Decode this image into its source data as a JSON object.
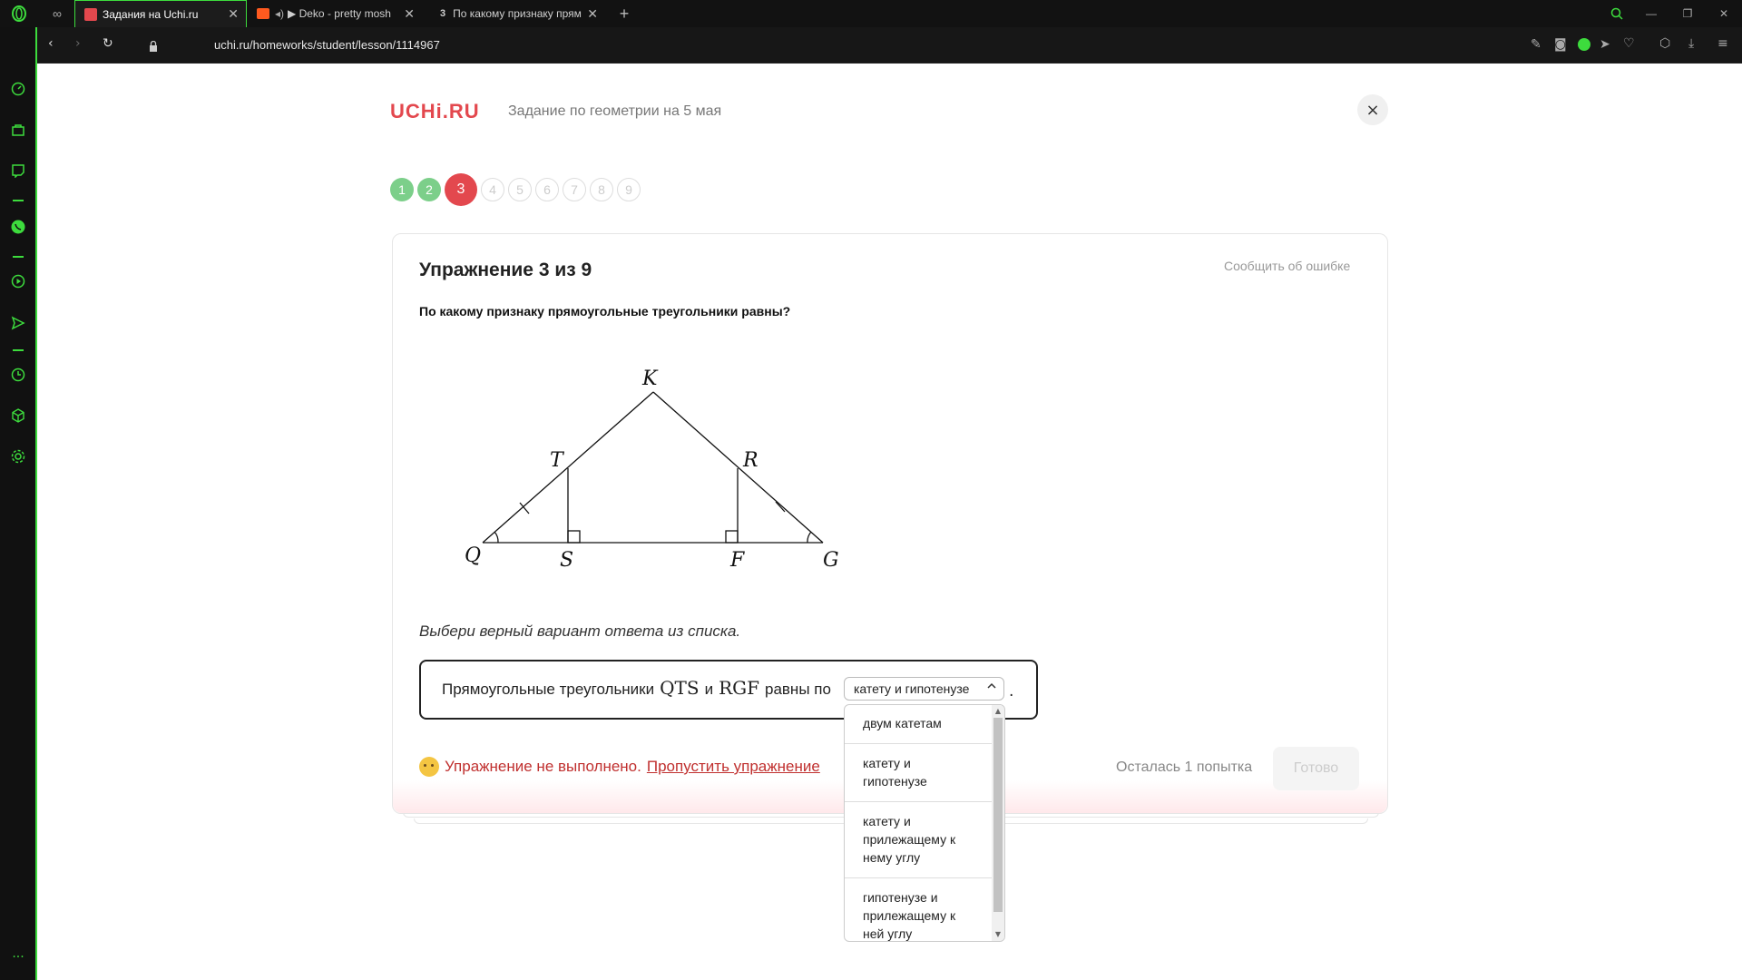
{
  "browser": {
    "tabs": [
      {
        "label": "Задания на Uchi.ru",
        "active": true
      },
      {
        "label": "▶ Deko - pretty mosh",
        "active": false
      },
      {
        "label": "По какому признаку прям",
        "active": false
      }
    ],
    "url": "uchi.ru/homeworks/student/lesson/1114967",
    "accent_color": "#3ddc3d"
  },
  "header": {
    "logo": "UCHi.RU",
    "subtitle": "Задание по геометрии на 5 мая",
    "close_icon": "×"
  },
  "steps": [
    {
      "label": "1",
      "state": "done"
    },
    {
      "label": "2",
      "state": "done"
    },
    {
      "label": "3",
      "state": "current"
    },
    {
      "label": "4",
      "state": "todo"
    },
    {
      "label": "5",
      "state": "todo"
    },
    {
      "label": "6",
      "state": "todo"
    },
    {
      "label": "7",
      "state": "todo"
    },
    {
      "label": "8",
      "state": "todo"
    },
    {
      "label": "9",
      "state": "todo"
    }
  ],
  "exercise": {
    "title": "Упражнение 3 из 9",
    "report_link": "Сообщить об ошибке",
    "question": "По какому признаку прямоугольные треугольники равны?",
    "figure_labels": {
      "K": "K",
      "T": "T",
      "R": "R",
      "Q": "Q",
      "S": "S",
      "F": "F",
      "G": "G"
    },
    "instruction": "Выбери верный вариант ответа из списка.",
    "answer": {
      "prefix": "Прямоугольные треугольники",
      "tri1": "QTS",
      "and": "и",
      "tri2": "RGF",
      "suffix": "равны по",
      "selected": "катету и гипотенузе",
      "end": "."
    },
    "options": [
      [
        "двум катетам"
      ],
      [
        "катету и",
        "гипотенузе"
      ],
      [
        "катету и",
        "прилежащему к",
        "нему углу"
      ],
      [
        "гипотенузе и",
        "прилежащему к",
        "ней углу"
      ]
    ],
    "status_text": "Упражнение не выполнено.",
    "skip_link": "Пропустить упражнение",
    "attempts": "Осталась 1 попытка",
    "done_button": "Готово"
  }
}
